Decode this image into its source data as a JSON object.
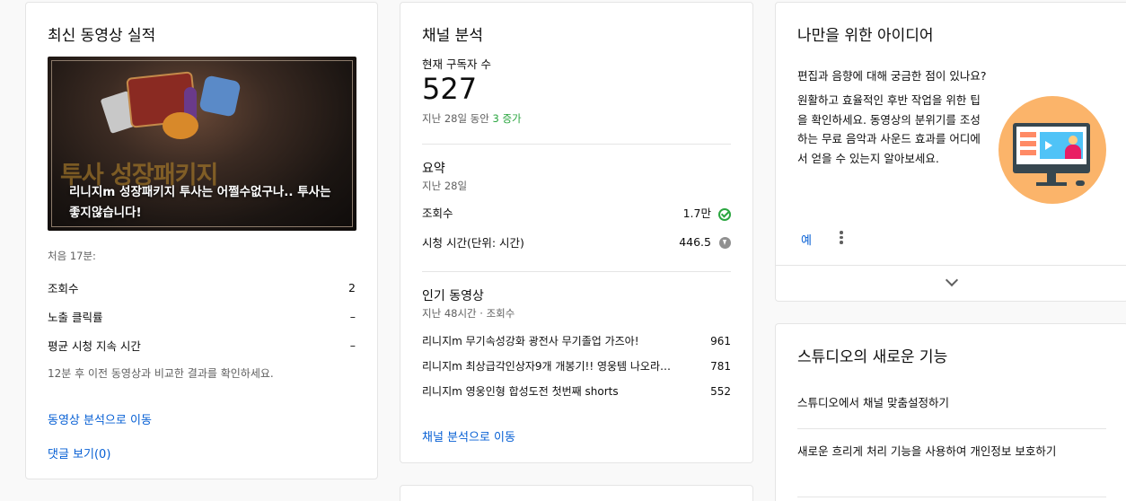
{
  "latest_video": {
    "title": "최신 동영상 실적",
    "thumbnail_overlay_text": "투사 성장패키지",
    "caption": "리니지m 성장패키지 투사는 어쩔수없구나.. 투사는 좋지않습니다!",
    "period_label": "처음 17분:",
    "stats": [
      {
        "label": "조회수",
        "value": "2"
      },
      {
        "label": "노출 클릭률",
        "value": "–"
      },
      {
        "label": "평균 시청 지속 시간",
        "value": "–"
      }
    ],
    "note": "12분 후 이전 동영상과 비교한 결과를 확인하세요.",
    "analytics_link": "동영상 분석으로 이동",
    "comments_link": "댓글 보기(0)"
  },
  "channel_analytics": {
    "title": "채널 분석",
    "subscribers_label": "현재 구독자 수",
    "subscribers": "527",
    "change_prefix": "지난 28일 동안 ",
    "change_value": "3 증가",
    "summary_title": "요약",
    "summary_period": "지난 28일",
    "views_label": "조회수",
    "views_value": "1.7만",
    "watch_label": "시청 시간(단위: 시간)",
    "watch_value": "446.5",
    "top_title": "인기 동영상",
    "top_period": "지난 48시간 · 조회수",
    "top_videos": [
      {
        "title": "리니지m 무기속성강화 광전사 무기졸업 가즈아!",
        "views": "961"
      },
      {
        "title": "리니지m 최상급각인상자9개 개봉기!! 영웅템 나오라…",
        "views": "781"
      },
      {
        "title": "리니지m 영웅인형 합성도전 첫번째 shorts",
        "views": "552"
      }
    ],
    "link": "채널 분석으로 이동"
  },
  "ideas": {
    "title": "나만을 위한 아이디어",
    "question": "편집과 음향에 대해 궁금한 점이 있나요?",
    "body": "원활하고 효율적인 후반 작업을 위한 팁을 확인하세요. 동영상의 분위기를 조성하는 무료 음악과 사운드 효과를 어디에서 얻을 수 있는지 알아보세요.",
    "yes_label": "예"
  },
  "studio_new": {
    "title": "스튜디오의 새로운 기능",
    "items": [
      "스튜디오에서 채널 맞춤설정하기",
      "새로운 흐리게 처리 기능을 사용하여 개인정보 보호하기"
    ]
  },
  "colors": {
    "link": "#065fd4",
    "positive": "#2ba640",
    "illustration_bg": "#fbb46a"
  }
}
